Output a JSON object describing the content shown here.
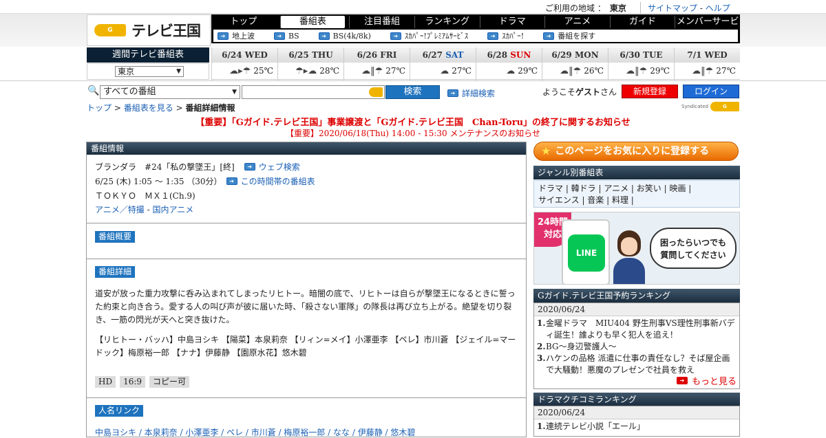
{
  "header": {
    "area_label": "ご利用の地域 ：",
    "area_value": "東京",
    "sitemap": "サイトマップ",
    "sep": "-",
    "help": "ヘルプ",
    "logo_text": "テレビ王国",
    "logo_g": "G GUIDE"
  },
  "nav": {
    "tabs": [
      "トップ",
      "番組表",
      "注目番組",
      "ランキング",
      "ドラマ",
      "アニメ",
      "ガイド",
      "メンバーサービス"
    ],
    "sub": [
      "地上波",
      "BS",
      "BS(4k/8k)",
      "ｽｶﾊﾟｰ!ﾌﾟﾚﾐｱﾑｻｰﾋﾞｽ",
      "ｽｶﾊﾟｰ!",
      "番組を探す"
    ]
  },
  "week": {
    "label": "週間テレビ番組表",
    "region": "東京",
    "days": [
      {
        "date": "6/24",
        "dow": "WED",
        "cls": "",
        "wx": "☁▸☂",
        "temp": "25℃"
      },
      {
        "date": "6/25",
        "dow": "THU",
        "cls": "",
        "wx": "☂▸☁",
        "temp": "28℃"
      },
      {
        "date": "6/26",
        "dow": "FRI",
        "cls": "",
        "wx": "☁‖☂",
        "temp": "27℃"
      },
      {
        "date": "6/27",
        "dow": "SAT",
        "cls": "sat",
        "wx": "☁",
        "temp": "27℃"
      },
      {
        "date": "6/28",
        "dow": "SUN",
        "cls": "sun",
        "wx": "☁",
        "temp": "29℃"
      },
      {
        "date": "6/29",
        "dow": "MON",
        "cls": "",
        "wx": "☁‖☂",
        "temp": "26℃"
      },
      {
        "date": "6/30",
        "dow": "TUE",
        "cls": "",
        "wx": "☁‖☂",
        "temp": "29℃"
      },
      {
        "date": "7/1",
        "dow": "WED",
        "cls": "",
        "wx": "☁‖☂",
        "temp": "27℃"
      }
    ]
  },
  "search": {
    "category": "すべての番組",
    "button": "検索",
    "advanced": "詳細検索",
    "welcome_pre": "ようこそ",
    "welcome_name": "ゲスト",
    "welcome_post": "さん",
    "register": "新規登録",
    "login": "ログイン"
  },
  "breadcrumb": {
    "top": "トップ",
    "list": "番組表を見る",
    "current": "番組詳細情報",
    "sep": ">"
  },
  "syndicated": "Syndicated",
  "notices": {
    "n1": "【重要】「Gガイド.テレビ王国」事業譲渡と「Gガイド.テレビ王国　Chan-Toru」の終了に関するお知らせ",
    "n2": "【重要】2020/06/18(Thu) 14:00 - 15:30 メンテナンスのお知らせ"
  },
  "program": {
    "panel_title": "番組情報",
    "title": "ブランダラ　#24「私の撃墜王」[終]",
    "web_search": "ウェブ検索",
    "time": "6/25 (木) 1:05 ～ 1:35 （30分）",
    "timeslot": "この時間帯の番組表",
    "channel": "ＴＯＫＹＯ　ＭＸ１(Ch.9)",
    "genre1": "アニメ／特撮",
    "genre_sep": "-",
    "genre2": "国内アニメ",
    "overview_tag": "番組概要",
    "detail_tag": "番組詳細",
    "description": "道安が放った重力攻撃に呑み込まれてしまったリヒトー。暗闇の底で、リヒトーは自らが撃墜王になるときに誓った約束と向き合う。愛する人の叫び声が彼に届いた時、「殺さない軍隊」の隊長は再び立ち上がる。絶望を切り裂き、一筋の閃光が天へと突き抜けた。",
    "cast": "【リヒトー・バッハ】中島ヨシキ 【陽菜】本泉莉奈 【リィン=メイ】小澤亜李 【ペレ】市川蒼 【ジェイル=マードック】梅原裕一郎 【ナナ】伊藤静 【園原水花】悠木碧",
    "badges": [
      "HD",
      "16:9",
      "コピー可"
    ],
    "people_tag": "人名リンク",
    "people": "中島ヨシキ / 本泉莉奈 / 小澤亜李 / ペレ / 市川蒼 / 梅原裕一郎 / なな / 伊藤静 / 悠木碧"
  },
  "sidebar": {
    "favorite": "このページをお気に入りに登録する",
    "genre_title": "ジャンル別番組表",
    "genre_line1": "ドラマ | 韓ドラ | アニメ | お笑い | 映画 |",
    "genre_line2": "サイエンス | 音楽 | 料理 |",
    "banner_24": "24時間",
    "banner_taiou": "対応",
    "banner_line": "LINE",
    "banner_msg1": "困ったらいつでも",
    "banner_msg2": "質問してください",
    "rank_title": "Gガイド.テレビ王国予約ランキング",
    "rank_date": "2020/06/24",
    "rank_items": [
      {
        "n": "1.",
        "t": "金曜ドラマ　MIU404 野生刑事VS理性刑事新バディ誕生！誰よりも早く犯人を追え！"
      },
      {
        "n": "2.",
        "t": "BG〜身辺警護人〜"
      },
      {
        "n": "3.",
        "t": "ハケンの品格 派遣に仕事の責任なし？そば屋企画で大騒動！悪魔のプレゼンで社員を救え"
      }
    ],
    "more": "もっと見る",
    "rank2_title": "ドラマクチコミランキング",
    "rank2_date": "2020/06/24",
    "rank2_item_n": "1.",
    "rank2_item_t": "連続テレビ小説「エール」"
  }
}
